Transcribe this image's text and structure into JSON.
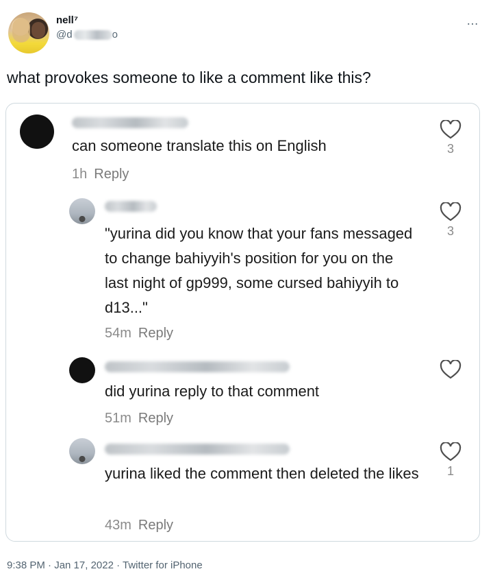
{
  "tweet": {
    "author_name": "nell⁷",
    "author_handle_prefix": "@d",
    "author_handle_suffix": "o",
    "more_icon": "…",
    "text": "what provokes someone to like a comment like this?",
    "footer": "9:38 PM · Jan 17, 2022 · Twitter for iPhone"
  },
  "comments": [
    {
      "text": "can someone translate this on English",
      "time": "1h",
      "reply_label": "Reply",
      "likes": "3"
    },
    {
      "text": "\"yurina did you know that your fans messaged to change bahiyyih's position for you on the last night of gp999, some cursed bahiyyih to d13...\"",
      "time": "54m",
      "reply_label": "Reply",
      "likes": "3"
    },
    {
      "text": "did yurina reply to that comment",
      "time": "51m",
      "reply_label": "Reply",
      "likes": ""
    },
    {
      "text": "yurina liked the comment then deleted the likes",
      "time": "43m",
      "reply_label": "Reply",
      "likes": "1"
    }
  ],
  "colors": {
    "like_icon": "#4d4d4d",
    "meta_text": "#8a8a8a"
  }
}
